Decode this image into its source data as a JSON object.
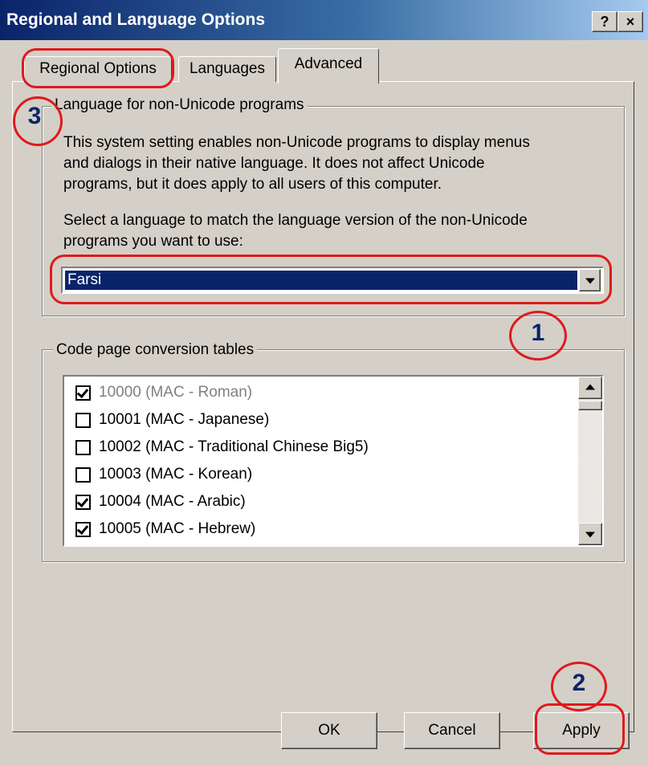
{
  "window": {
    "title": "Regional and Language Options",
    "help_button": "?",
    "close_button": "×"
  },
  "tabs": [
    {
      "label": "Regional Options"
    },
    {
      "label": "Languages"
    },
    {
      "label": "Advanced",
      "selected": true
    }
  ],
  "language_group": {
    "title": "Language for non-Unicode programs",
    "description_lines": [
      "This system setting enables non-Unicode programs to display menus",
      "and dialogs in their native language. It does not affect Unicode",
      "programs, but it does apply to all users of this computer."
    ],
    "prompt_lines": [
      "Select a language to match the language version of the non-Unicode",
      "programs you want to use:"
    ],
    "selected_language": "Farsi"
  },
  "codepage_group": {
    "title": "Code page conversion tables",
    "items": [
      {
        "label": "10000 (MAC - Roman)",
        "checked": true,
        "dimmed": true
      },
      {
        "label": "10001 (MAC - Japanese)",
        "checked": false
      },
      {
        "label": "10002 (MAC - Traditional Chinese Big5)",
        "checked": false
      },
      {
        "label": "10003 (MAC - Korean)",
        "checked": false
      },
      {
        "label": "10004 (MAC - Arabic)",
        "checked": true
      },
      {
        "label": "10005 (MAC - Hebrew)",
        "checked": true
      }
    ]
  },
  "buttons": {
    "ok": "OK",
    "cancel": "Cancel",
    "apply": "Apply"
  },
  "annotations": {
    "step1": "1",
    "step2": "2",
    "step3": "3",
    "color": "#e01a1a",
    "number_color": "#0a246a"
  },
  "colors": {
    "titlebar_start": "#0a246a",
    "titlebar_end": "#a6caf0",
    "selection": "#0a246a",
    "face": "#d4d0c8"
  }
}
